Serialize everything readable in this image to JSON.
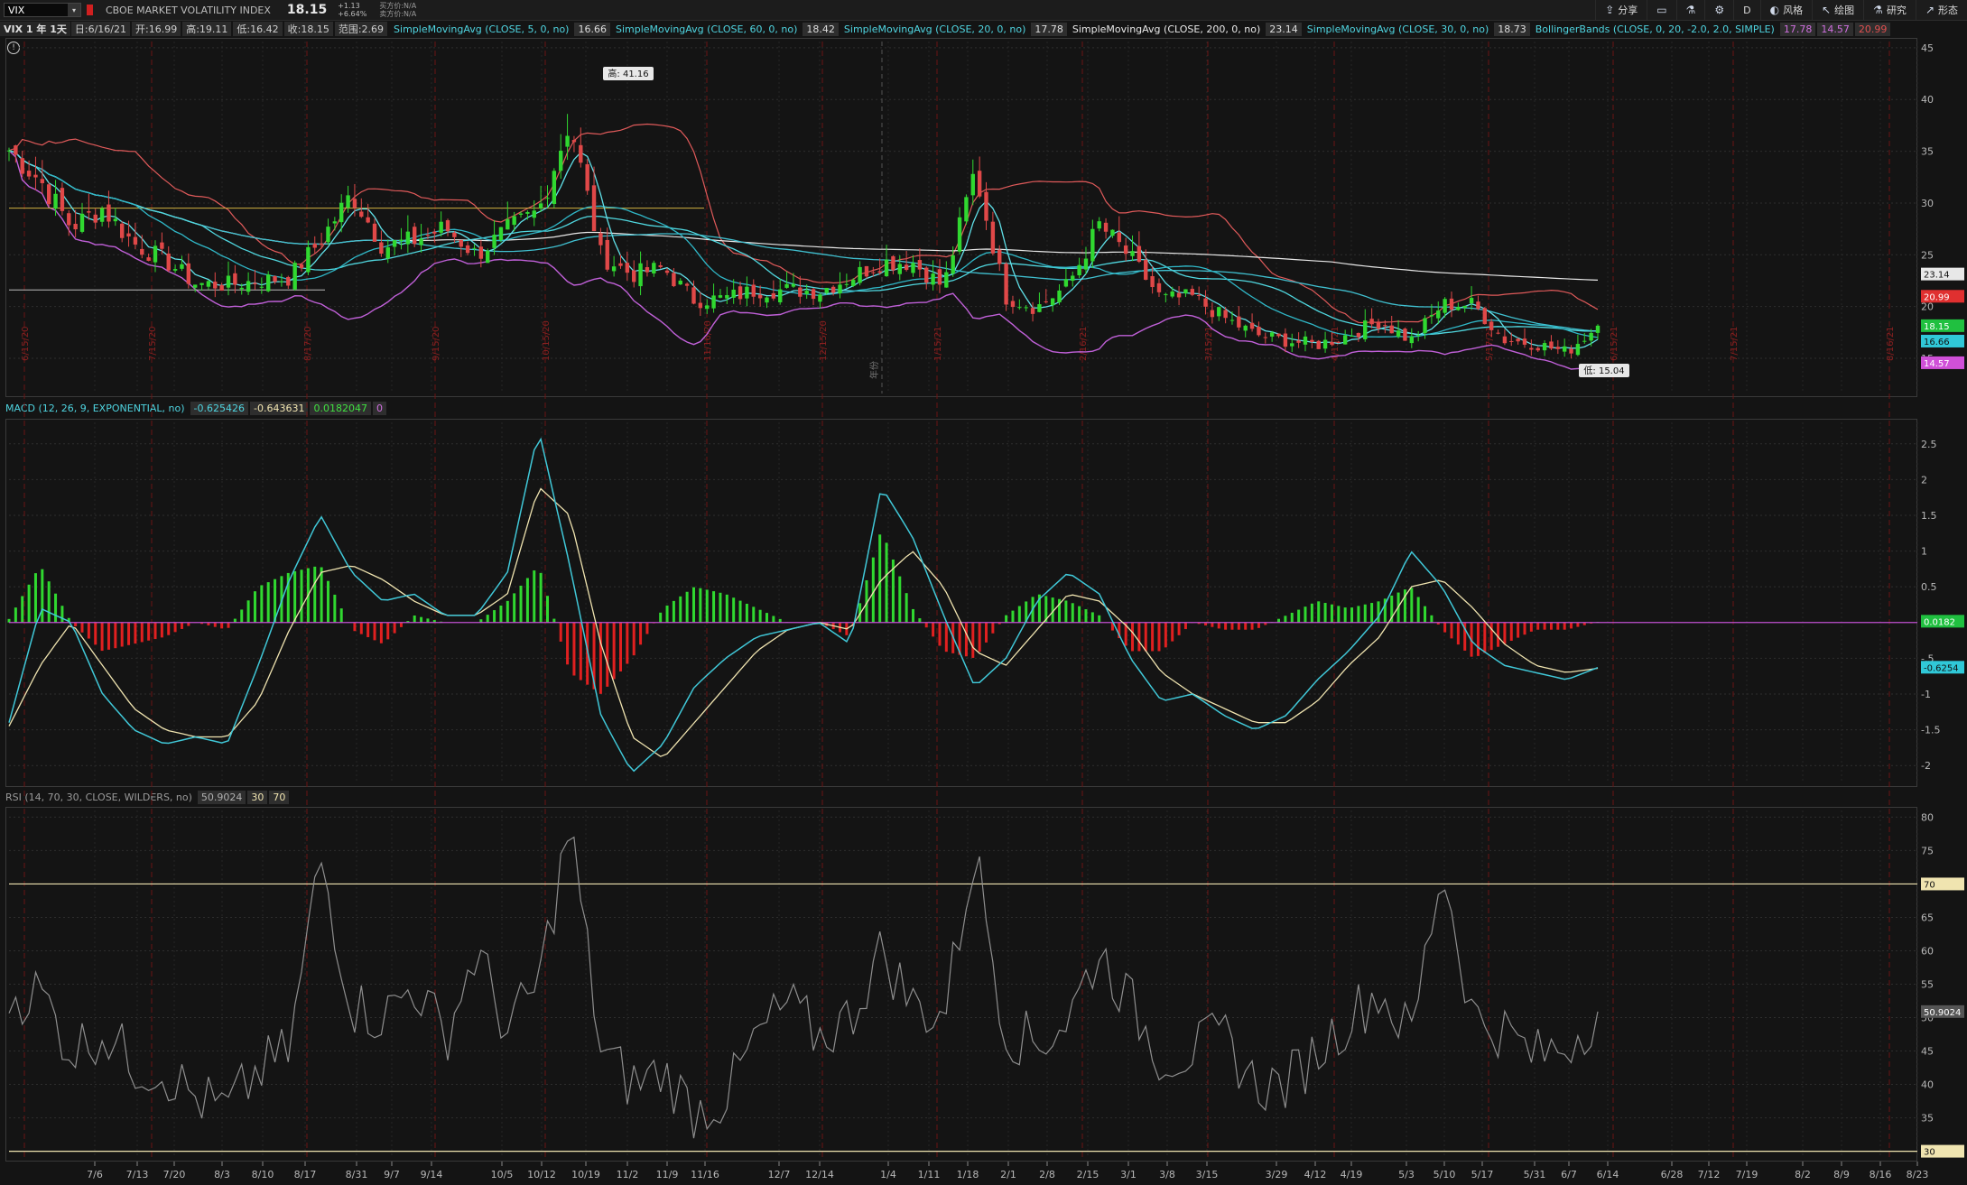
{
  "header": {
    "symbol": "VIX",
    "symbol_name": "CBOE MARKET VOLATILITY INDEX",
    "price": "18.15",
    "change_abs": "+1.13",
    "change_pct": "+6.64%",
    "bid": "买方价:N/A",
    "ask": "卖方价:N/A"
  },
  "toolbar": [
    {
      "icon": "share-icon",
      "glyph": "⇪",
      "label": "分享"
    },
    {
      "icon": "layout-icon",
      "glyph": "▭",
      "label": ""
    },
    {
      "icon": "flask-icon",
      "glyph": "⚗",
      "label": ""
    },
    {
      "icon": "gear-icon",
      "glyph": "⚙",
      "label": ""
    },
    {
      "icon": "aggregation-icon",
      "glyph": "",
      "label": "D"
    },
    {
      "icon": "style-icon",
      "glyph": "◐",
      "label": "风格"
    },
    {
      "icon": "draw-icon",
      "glyph": "↖",
      "label": "绘图"
    },
    {
      "icon": "study-icon",
      "glyph": "⚗",
      "label": "研究"
    },
    {
      "icon": "pattern-icon",
      "glyph": "↗",
      "label": "形态"
    }
  ],
  "price_header": {
    "period": "VIX 1 年 1天",
    "date": "日:6/16/21",
    "open": "开:16.99",
    "high": "高:19.11",
    "low": "低:16.42",
    "close": "收:18.15",
    "range": "范围:2.69",
    "studies": [
      {
        "label": "SimpleMovingAvg (CLOSE, 5, 0, no)",
        "value": "16.66",
        "color": "#4fd4e0"
      },
      {
        "label": "SimpleMovingAvg (CLOSE, 60, 0, no)",
        "value": "18.42",
        "color": "#4fd4e0"
      },
      {
        "label": "SimpleMovingAvg (CLOSE, 20, 0, no)",
        "value": "17.78",
        "color": "#4fd4e0"
      },
      {
        "label": "SimpleMovingAvg (CLOSE, 200, 0, no)",
        "value": "23.14",
        "color": "#e8e8e8"
      },
      {
        "label": "SimpleMovingAvg (CLOSE, 30, 0, no)",
        "value": "18.73",
        "color": "#4fd4e0"
      }
    ],
    "bollinger_label": "BollingerBands (CLOSE, 0, 20, -2.0, 2.0, SIMPLE)",
    "bollinger_values": [
      {
        "value": "17.78",
        "color": "#d070e0"
      },
      {
        "value": "14.57",
        "color": "#d070e0"
      },
      {
        "value": "20.99",
        "color": "#e05050"
      }
    ],
    "overlay_label": "VIX 1 年 1天"
  },
  "macd_header": {
    "label": "MACD (12, 26, 9, EXPONENTIAL, no)",
    "values": [
      {
        "value": "-0.625426",
        "color": "#4fd4e0"
      },
      {
        "value": "-0.643631",
        "color": "#f0e4b0"
      },
      {
        "value": "0.0182047",
        "color": "#40e040"
      },
      {
        "value": "0",
        "color": "#d070e0"
      }
    ]
  },
  "rsi_header": {
    "label": "RSI (14, 70, 30, CLOSE, WILDERS, no)",
    "values": [
      {
        "value": "50.9024",
        "color": "#b0b0b0"
      },
      {
        "value": "30",
        "color": "#f0e4b0"
      },
      {
        "value": "70",
        "color": "#f0e4b0"
      }
    ]
  },
  "annotations": {
    "high_label": "高: 41.16",
    "low_label": "低: 15.04",
    "divider_label": "年份"
  },
  "price_axis": {
    "ticks": [
      "15",
      "20",
      "25",
      "30",
      "35",
      "40",
      "45"
    ],
    "tick_values": [
      15,
      20,
      25,
      30,
      35,
      40,
      45
    ],
    "min": 11.6,
    "max": 45.6,
    "badges": [
      {
        "value": "23.14",
        "bg": "#e8e8e8",
        "fg": "#111"
      },
      {
        "value": "20.99",
        "bg": "#e03030",
        "fg": "#fff"
      },
      {
        "value": "18.15",
        "bg": "#20c040",
        "fg": "#fff"
      },
      {
        "value": "16.66",
        "bg": "#30c8d8",
        "fg": "#111"
      },
      {
        "value": "14.57",
        "bg": "#d050d8",
        "fg": "#fff"
      }
    ]
  },
  "macd_axis": {
    "ticks": [
      "-2",
      "-1.5",
      "-1",
      "-.5",
      "0.5",
      "1",
      "1.5",
      "2",
      "2.5"
    ],
    "tick_values": [
      -2,
      -1.5,
      -1,
      -0.5,
      0.5,
      1,
      1.5,
      2,
      2.5
    ],
    "min": -2.25,
    "max": 2.8,
    "badges": [
      {
        "value": "0.0182",
        "bg": "#20c040",
        "fg": "#fff"
      },
      {
        "value": "-0.6254",
        "bg": "#30c8d8",
        "fg": "#111"
      }
    ]
  },
  "rsi_axis": {
    "ticks": [
      "35",
      "40",
      "45",
      "50",
      "55",
      "60",
      "65",
      "75",
      "80"
    ],
    "tick_values": [
      35,
      40,
      45,
      50,
      55,
      60,
      65,
      75,
      80
    ],
    "min": 29,
    "max": 81,
    "badges": [
      {
        "value": "70",
        "bg": "#f0e4b0",
        "fg": "#111"
      },
      {
        "value": "50.9024",
        "bg": "#555",
        "fg": "#fff"
      },
      {
        "value": "30",
        "bg": "#f0e4b0",
        "fg": "#111"
      }
    ]
  },
  "date_axis": {
    "labels": [
      "7/6",
      "7/13",
      "7/20",
      "8/3",
      "8/10",
      "8/17",
      "8/31",
      "9/7",
      "9/14",
      "10/5",
      "10/12",
      "10/19",
      "11/2",
      "11/9",
      "11/16",
      "12/7",
      "12/14",
      "1/4",
      "1/11",
      "1/18",
      "2/1",
      "2/8",
      "2/15",
      "3/1",
      "3/8",
      "3/15",
      "3/29",
      "4/12",
      "4/19",
      "5/3",
      "5/10",
      "5/17",
      "5/31",
      "6/7",
      "6/14",
      "6/28",
      "7/12",
      "7/19",
      "8/2",
      "8/9",
      "8/16",
      "8/23"
    ],
    "positions": [
      105,
      152,
      193,
      246,
      291,
      338,
      395,
      434,
      478,
      556,
      600,
      649,
      695,
      739,
      781,
      863,
      908,
      984,
      1029,
      1072,
      1117,
      1160,
      1205,
      1250,
      1293,
      1337,
      1414,
      1457,
      1497,
      1558,
      1600,
      1642,
      1700,
      1738,
      1781,
      1852,
      1893,
      1935,
      1997,
      2040,
      2083,
      2124
    ]
  },
  "vertical_markers": {
    "positions": [
      27,
      168,
      340,
      482,
      604,
      783,
      911,
      1038,
      1199,
      1338,
      1478,
      1649,
      1787,
      1920,
      2093
    ],
    "labels": [
      "6/15/20",
      "7/15/20",
      "8/17/20",
      "9/15/20",
      "10/15/20",
      "11/16/20",
      "12/15/20",
      "1/15/21",
      "2/16/21",
      "3/15/21",
      "4/15/21",
      "5/17/21",
      "6/15/21",
      "7/15/21",
      "8/16/21"
    ]
  },
  "chart_data": [
    {
      "type": "candlestick",
      "title": "VIX 1 年 1天",
      "x": [
        "6/22/20",
        "6/29/20",
        "7/6/20",
        "7/13/20",
        "7/20/20",
        "7/27/20",
        "8/3/20",
        "8/10/20",
        "8/17/20",
        "8/24/20",
        "8/31/20",
        "9/7/20",
        "9/14/20",
        "9/21/20",
        "9/28/20",
        "10/5/20",
        "10/12/20",
        "10/19/20",
        "10/26/20",
        "11/2/20",
        "11/9/20",
        "11/16/20",
        "11/23/20",
        "11/30/20",
        "12/7/20",
        "12/14/20",
        "12/21/20",
        "12/28/20",
        "1/4/21",
        "1/11/21",
        "1/18/21",
        "1/25/21",
        "2/1/21",
        "2/8/21",
        "2/15/21",
        "2/22/21",
        "3/1/21",
        "3/8/21",
        "3/15/21",
        "3/22/21",
        "3/29/21",
        "4/5/21",
        "4/12/21",
        "4/19/21",
        "4/26/21",
        "5/3/21",
        "5/10/21",
        "5/17/21",
        "5/24/21",
        "5/31/21",
        "6/7/21",
        "6/14/21"
      ],
      "close": [
        35.1,
        32.2,
        27.7,
        29.5,
        26.1,
        24.5,
        22.2,
        22.1,
        22.5,
        22.8,
        26.4,
        30.9,
        25.8,
        26.4,
        27.6,
        25.0,
        27.4,
        29.2,
        38.0,
        24.9,
        23.1,
        23.7,
        20.6,
        20.8,
        21.6,
        21.6,
        21.5,
        22.8,
        24.3,
        24.3,
        21.9,
        33.1,
        20.9,
        19.9,
        22.1,
        27.9,
        24.7,
        20.7,
        20.9,
        18.9,
        17.3,
        16.7,
        16.3,
        17.3,
        18.6,
        16.7,
        20.2,
        20.2,
        16.8,
        16.4,
        15.6,
        18.15
      ],
      "high_annotation": "高: 41.16",
      "low_annotation": "低: 15.04",
      "ylim": [
        11.6,
        45.6
      ],
      "overlays": [
        "SimpleMovingAvg (CLOSE, 5, 0, no)",
        "SimpleMovingAvg (CLOSE, 20, 0, no)",
        "SimpleMovingAvg (CLOSE, 30, 0, no)",
        "SimpleMovingAvg (CLOSE, 60, 0, no)",
        "SimpleMovingAvg (CLOSE, 200, 0, no)",
        "BollingerBands (CLOSE, 0, 20, -2.0, 2.0, SIMPLE)"
      ]
    },
    {
      "type": "line",
      "title": "MACD (12, 26, 9, EXPONENTIAL, no)",
      "x_start": "6/22/20",
      "x_end": "6/16/21",
      "series": [
        {
          "name": "Value",
          "color": "#4fd4e0",
          "values": [
            -1.4,
            0.2,
            0.0,
            -1.0,
            -1.5,
            -1.7,
            -1.6,
            -1.7,
            -0.6,
            0.6,
            1.5,
            0.7,
            0.3,
            0.4,
            0.1,
            0.1,
            0.7,
            2.7,
            0.8,
            -1.3,
            -2.1,
            -1.7,
            -0.9,
            -0.5,
            -0.2,
            -0.1,
            0.0,
            -0.3,
            1.9,
            1.2,
            0.1,
            -0.9,
            -0.5,
            0.3,
            0.7,
            0.4,
            -0.5,
            -1.1,
            -1.0,
            -1.3,
            -1.5,
            -1.3,
            -0.8,
            -0.4,
            0.1,
            1.0,
            0.5,
            -0.3,
            -0.6,
            -0.7,
            -0.8,
            -0.63
          ]
        },
        {
          "name": "Avg",
          "color": "#f0e4b0",
          "values": [
            -1.45,
            -0.6,
            0.0,
            -0.6,
            -1.2,
            -1.5,
            -1.6,
            -1.6,
            -1.1,
            -0.1,
            0.7,
            0.8,
            0.6,
            0.3,
            0.1,
            0.1,
            0.4,
            1.9,
            1.5,
            -0.3,
            -1.6,
            -1.9,
            -1.4,
            -0.9,
            -0.4,
            -0.1,
            0.0,
            -0.1,
            0.6,
            1.0,
            0.5,
            -0.4,
            -0.6,
            -0.1,
            0.4,
            0.3,
            -0.1,
            -0.7,
            -1.0,
            -1.2,
            -1.4,
            -1.4,
            -1.1,
            -0.6,
            -0.2,
            0.5,
            0.6,
            0.2,
            -0.3,
            -0.6,
            -0.7,
            -0.64
          ]
        },
        {
          "name": "Diff",
          "color": "#40e040",
          "values": [
            0.05,
            0.8,
            0.0,
            -0.4,
            -0.3,
            -0.2,
            0.0,
            -0.1,
            0.5,
            0.7,
            0.8,
            -0.1,
            -0.3,
            0.1,
            0.0,
            0.0,
            0.3,
            0.8,
            -0.7,
            -1.0,
            -0.5,
            0.2,
            0.5,
            0.4,
            0.2,
            0.0,
            0.0,
            -0.2,
            1.3,
            0.2,
            -0.4,
            -0.5,
            0.1,
            0.4,
            0.3,
            0.1,
            -0.4,
            -0.4,
            0.0,
            -0.1,
            -0.1,
            0.1,
            0.3,
            0.2,
            0.3,
            0.5,
            -0.1,
            -0.5,
            -0.3,
            -0.1,
            -0.1,
            0.018
          ]
        }
      ],
      "ylim": [
        -2.25,
        2.8
      ]
    },
    {
      "type": "line",
      "title": "RSI (14, 70, 30, CLOSE, WILDERS, no)",
      "x_start": "6/22/20",
      "x_end": "6/16/21",
      "series": [
        {
          "name": "RSI",
          "color": "#9a9a9a",
          "values": [
            53,
            54,
            45,
            48,
            43,
            42,
            38,
            36,
            42,
            45,
            74,
            52,
            50,
            55,
            47,
            60,
            48,
            55,
            79,
            45,
            40,
            42,
            36,
            38,
            47,
            52,
            47,
            50,
            60,
            52,
            50,
            75,
            48,
            46,
            50,
            60,
            52,
            44,
            45,
            47,
            40,
            40,
            45,
            50,
            54,
            47,
            73,
            50,
            48,
            44,
            46,
            51
          ]
        },
        {
          "name": "OverBought",
          "color": "#f0e4b0",
          "values": [
            70
          ]
        },
        {
          "name": "OverSold",
          "color": "#f0e4b0",
          "values": [
            30
          ]
        }
      ],
      "ylim": [
        29,
        81
      ]
    }
  ]
}
